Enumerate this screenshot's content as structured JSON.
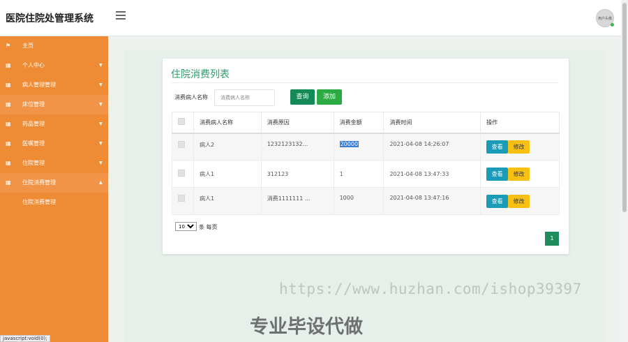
{
  "app": {
    "title": "医院住院处管理系统",
    "avatar_text": "用户头像",
    "status_url": "javascript:void(0);"
  },
  "sidebar": {
    "items": [
      {
        "label": "主页",
        "icon": "flag-icon",
        "glyph": "⚑",
        "has_arrow": false
      },
      {
        "label": "个人中心",
        "icon": "grid-icon",
        "glyph": "▦",
        "has_arrow": true
      },
      {
        "label": "病人管理管理",
        "icon": "grid-icon",
        "glyph": "▦",
        "has_arrow": true
      },
      {
        "label": "床位管理",
        "icon": "grid-icon",
        "glyph": "▦",
        "has_arrow": true
      },
      {
        "label": "药品管理",
        "icon": "grid-icon",
        "glyph": "▦",
        "has_arrow": true
      },
      {
        "label": "医嘱管理",
        "icon": "grid-icon",
        "glyph": "▦",
        "has_arrow": true
      },
      {
        "label": "住院管理",
        "icon": "grid-icon",
        "glyph": "▦",
        "has_arrow": true
      },
      {
        "label": "住院消费管理",
        "icon": "grid-icon",
        "glyph": "▦",
        "has_arrow": true,
        "expanded": true
      }
    ],
    "sub_item": "住院消费管理",
    "arrow_down": "▼",
    "arrow_up": "▲"
  },
  "page": {
    "title": "住院消费列表",
    "search_label": "消费病人名称",
    "search_placeholder": "消费病人名称",
    "search_value": "",
    "query_button": "查询",
    "add_button": "添加"
  },
  "table": {
    "headers": [
      "消费病人名称",
      "消费原因",
      "消费金额",
      "消费时间",
      "操作"
    ],
    "rows": [
      {
        "patient": "病人2",
        "reason": "1232123132...",
        "amount": "20000",
        "time": "2021-04-08 14:26:07",
        "view": "查看",
        "edit": "修改",
        "amount_selected": true
      },
      {
        "patient": "病人1",
        "reason": "312123",
        "amount": "1",
        "time": "2021-04-08 13:47:33",
        "view": "查看",
        "edit": "修改",
        "amount_selected": false
      },
      {
        "patient": "病人1",
        "reason": "消费1111111 ...",
        "amount": "1000",
        "time": "2021-04-08 13:47:16",
        "view": "查看",
        "edit": "修改",
        "amount_selected": false
      }
    ]
  },
  "pagination": {
    "page_size": "10",
    "page_size_options": [
      "10"
    ],
    "page_size_suffix": "条 每页",
    "current_page": "1"
  },
  "watermark": {
    "url": "https://www.huzhan.com/ishop39397",
    "text": "专业毕设代做"
  },
  "colors": {
    "sidebar": "#ef8b35",
    "accent_green": "#2e9c6b",
    "query_button": "#138a57",
    "add_button": "#2caa44",
    "view_button": "#1a9cb8",
    "edit_button": "#f7c012"
  }
}
